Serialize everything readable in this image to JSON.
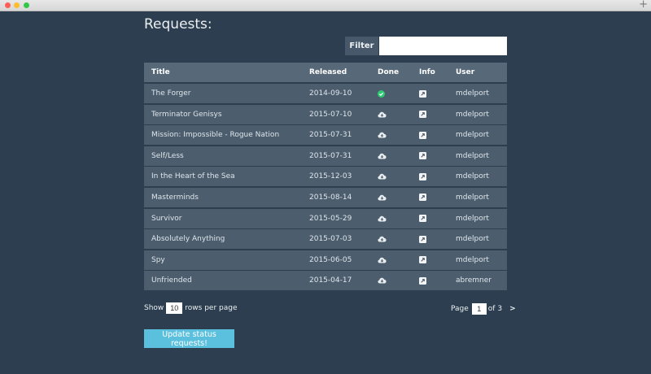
{
  "page": {
    "title": "Requests:"
  },
  "filter": {
    "label": "Filter",
    "value": "",
    "placeholder": ""
  },
  "table": {
    "headers": {
      "title": "Title",
      "released": "Released",
      "done": "Done",
      "info": "Info",
      "user": "User"
    },
    "rows": [
      {
        "title": "The Forger",
        "released": "2014-09-10",
        "done_icon": "check-circle-icon",
        "info_icon": "external-link-icon",
        "user": "mdelport"
      },
      {
        "title": "Terminator Genisys",
        "released": "2015-07-10",
        "done_icon": "cloud-download-icon",
        "info_icon": "external-link-icon",
        "user": "mdelport"
      },
      {
        "title": "Mission: Impossible - Rogue Nation",
        "released": "2015-07-31",
        "done_icon": "cloud-download-icon",
        "info_icon": "external-link-icon",
        "user": "mdelport"
      },
      {
        "title": "Self/Less",
        "released": "2015-07-31",
        "done_icon": "cloud-download-icon",
        "info_icon": "external-link-icon",
        "user": "mdelport"
      },
      {
        "title": "In the Heart of the Sea",
        "released": "2015-12-03",
        "done_icon": "cloud-download-icon",
        "info_icon": "external-link-icon",
        "user": "mdelport"
      },
      {
        "title": "Masterminds",
        "released": "2015-08-14",
        "done_icon": "cloud-download-icon",
        "info_icon": "external-link-icon",
        "user": "mdelport"
      },
      {
        "title": "Survivor",
        "released": "2015-05-29",
        "done_icon": "cloud-download-icon",
        "info_icon": "external-link-icon",
        "user": "mdelport"
      },
      {
        "title": "Absolutely Anything",
        "released": "2015-07-03",
        "done_icon": "cloud-download-icon",
        "info_icon": "external-link-icon",
        "user": "mdelport"
      },
      {
        "title": "Spy",
        "released": "2015-06-05",
        "done_icon": "cloud-download-icon",
        "info_icon": "external-link-icon",
        "user": "mdelport"
      },
      {
        "title": "Unfriended",
        "released": "2015-04-17",
        "done_icon": "cloud-download-icon",
        "info_icon": "external-link-icon",
        "user": "abremner"
      }
    ]
  },
  "pagination": {
    "show_label": "Show",
    "rows_per_page": "10",
    "rows_suffix": "rows per page",
    "page_label": "Page",
    "current_page": "1",
    "of_label": "of 3",
    "next_label": ">"
  },
  "actions": {
    "update_label": "Update status requests!"
  },
  "colors": {
    "background": "#2c3e50",
    "row": "#4c5d6e",
    "header_row": "#576878",
    "done": "#2ecc71",
    "button": "#5bc0de"
  }
}
